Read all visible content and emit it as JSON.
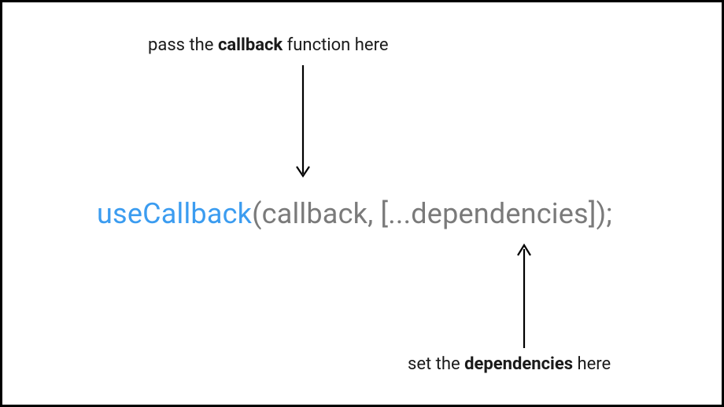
{
  "annotations": {
    "top": {
      "prefix": "pass the ",
      "bold": "callback",
      "suffix": " function here"
    },
    "bottom": {
      "prefix": "set the ",
      "bold": "dependencies",
      "suffix": " here"
    }
  },
  "code": {
    "hook": "useCallback",
    "rest": "(callback, [...dependencies]);"
  },
  "colors": {
    "hook": "#3b9cf0",
    "rest": "#7a7a7a",
    "text": "#1a1a1a"
  }
}
